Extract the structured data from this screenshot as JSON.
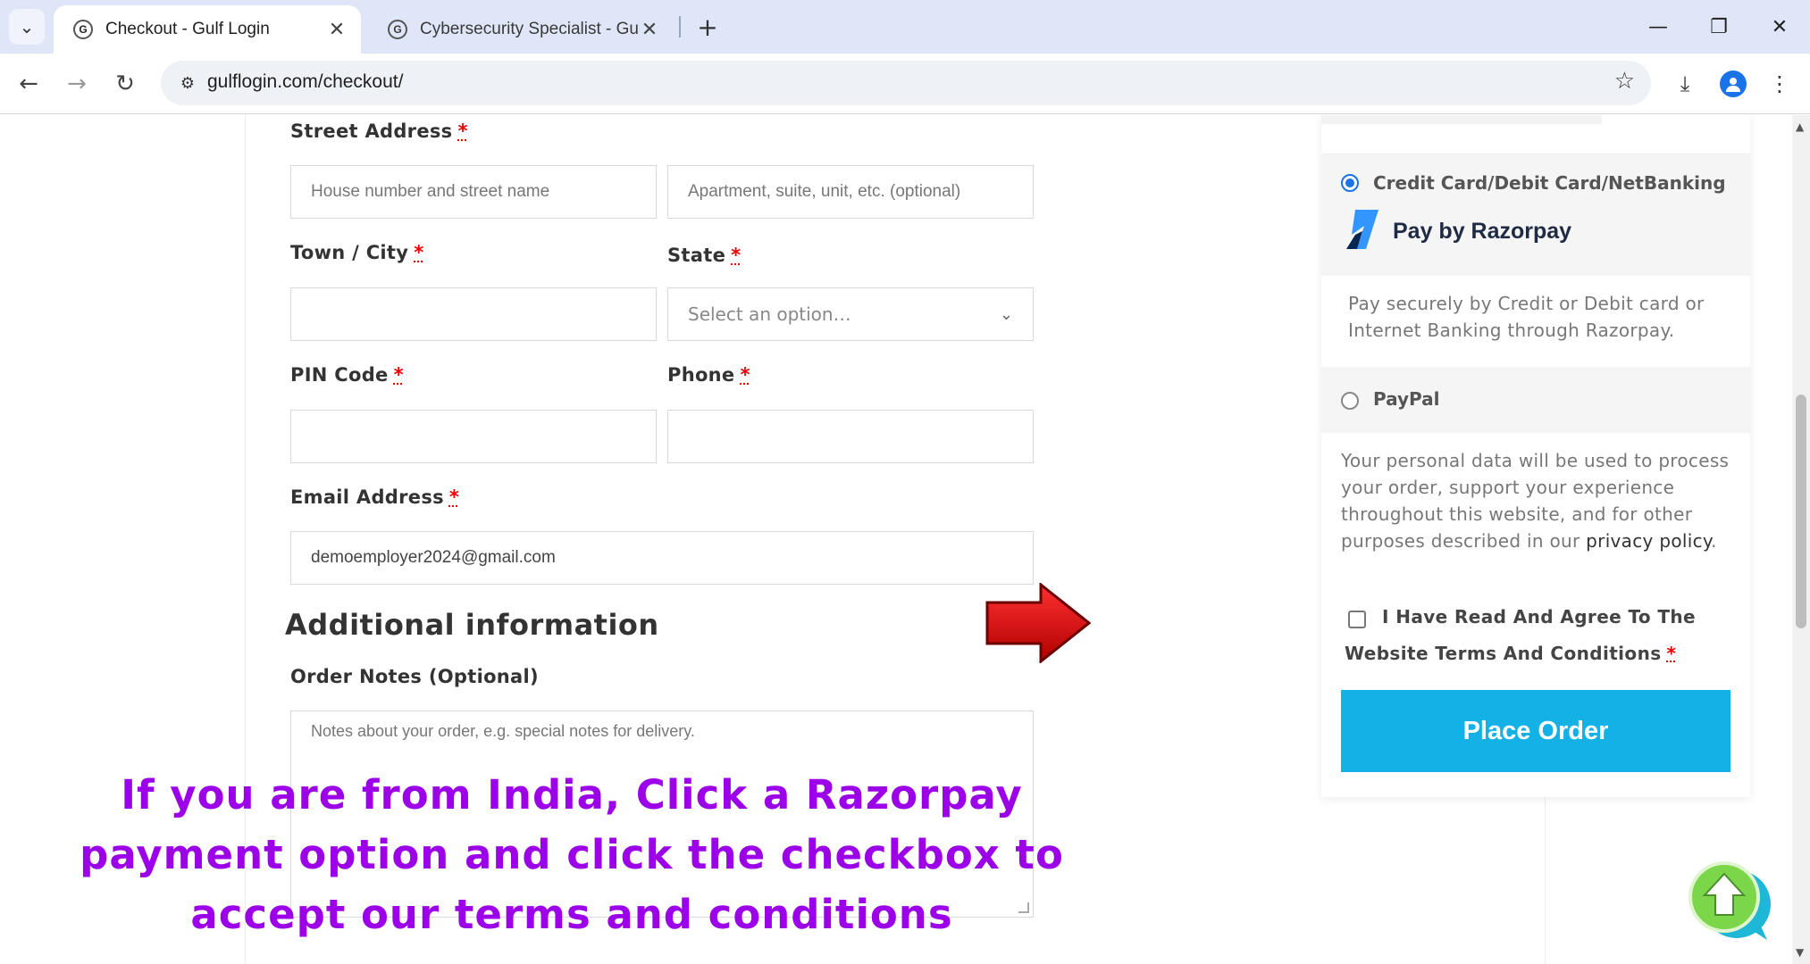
{
  "browser": {
    "tabs": [
      {
        "title": "Checkout - Gulf Login",
        "active": true
      },
      {
        "title": "Cybersecurity Specialist - Gulf L",
        "active": false
      }
    ],
    "url": "gulflogin.com/checkout/"
  },
  "form": {
    "street_label": "Street Address",
    "street_placeholder": "House number and street name",
    "apartment_placeholder": "Apartment, suite, unit, etc. (optional)",
    "town_label": "Town / City",
    "state_label": "State",
    "state_selected": "Select an option…",
    "pin_label": "PIN Code",
    "phone_label": "Phone",
    "email_label": "Email Address",
    "email_value": "demoemployer2024@gmail.com",
    "required_mark": "*",
    "additional_heading": "Additional information",
    "notes_label": "Order Notes (Optional)",
    "notes_placeholder": "Notes about your order, e.g. special notes for delivery."
  },
  "payment": {
    "razorpay_option_label": "Credit Card/Debit Card/NetBanking",
    "razorpay_title": "Pay by Razorpay",
    "razorpay_description": "Pay securely by Credit or Debit card or Internet Banking through Razorpay.",
    "paypal_label": "PayPal",
    "privacy_text": "Your personal data will be used to process your order, support your experience throughout this website, and for other purposes described in our",
    "privacy_link": "privacy policy",
    "terms_line1": "I Have Read And Agree To The",
    "terms_line2": "Website Terms And Conditions",
    "place_order": "Place Order"
  },
  "overlay": {
    "instruction": "If you are from India, Click a Razorpay payment option and click the checkbox to accept our terms and conditions"
  },
  "colors": {
    "accent_button": "#14b1e7",
    "overlay_text": "#9b00e8",
    "arrow": "#d01818",
    "required": "#e00000"
  }
}
